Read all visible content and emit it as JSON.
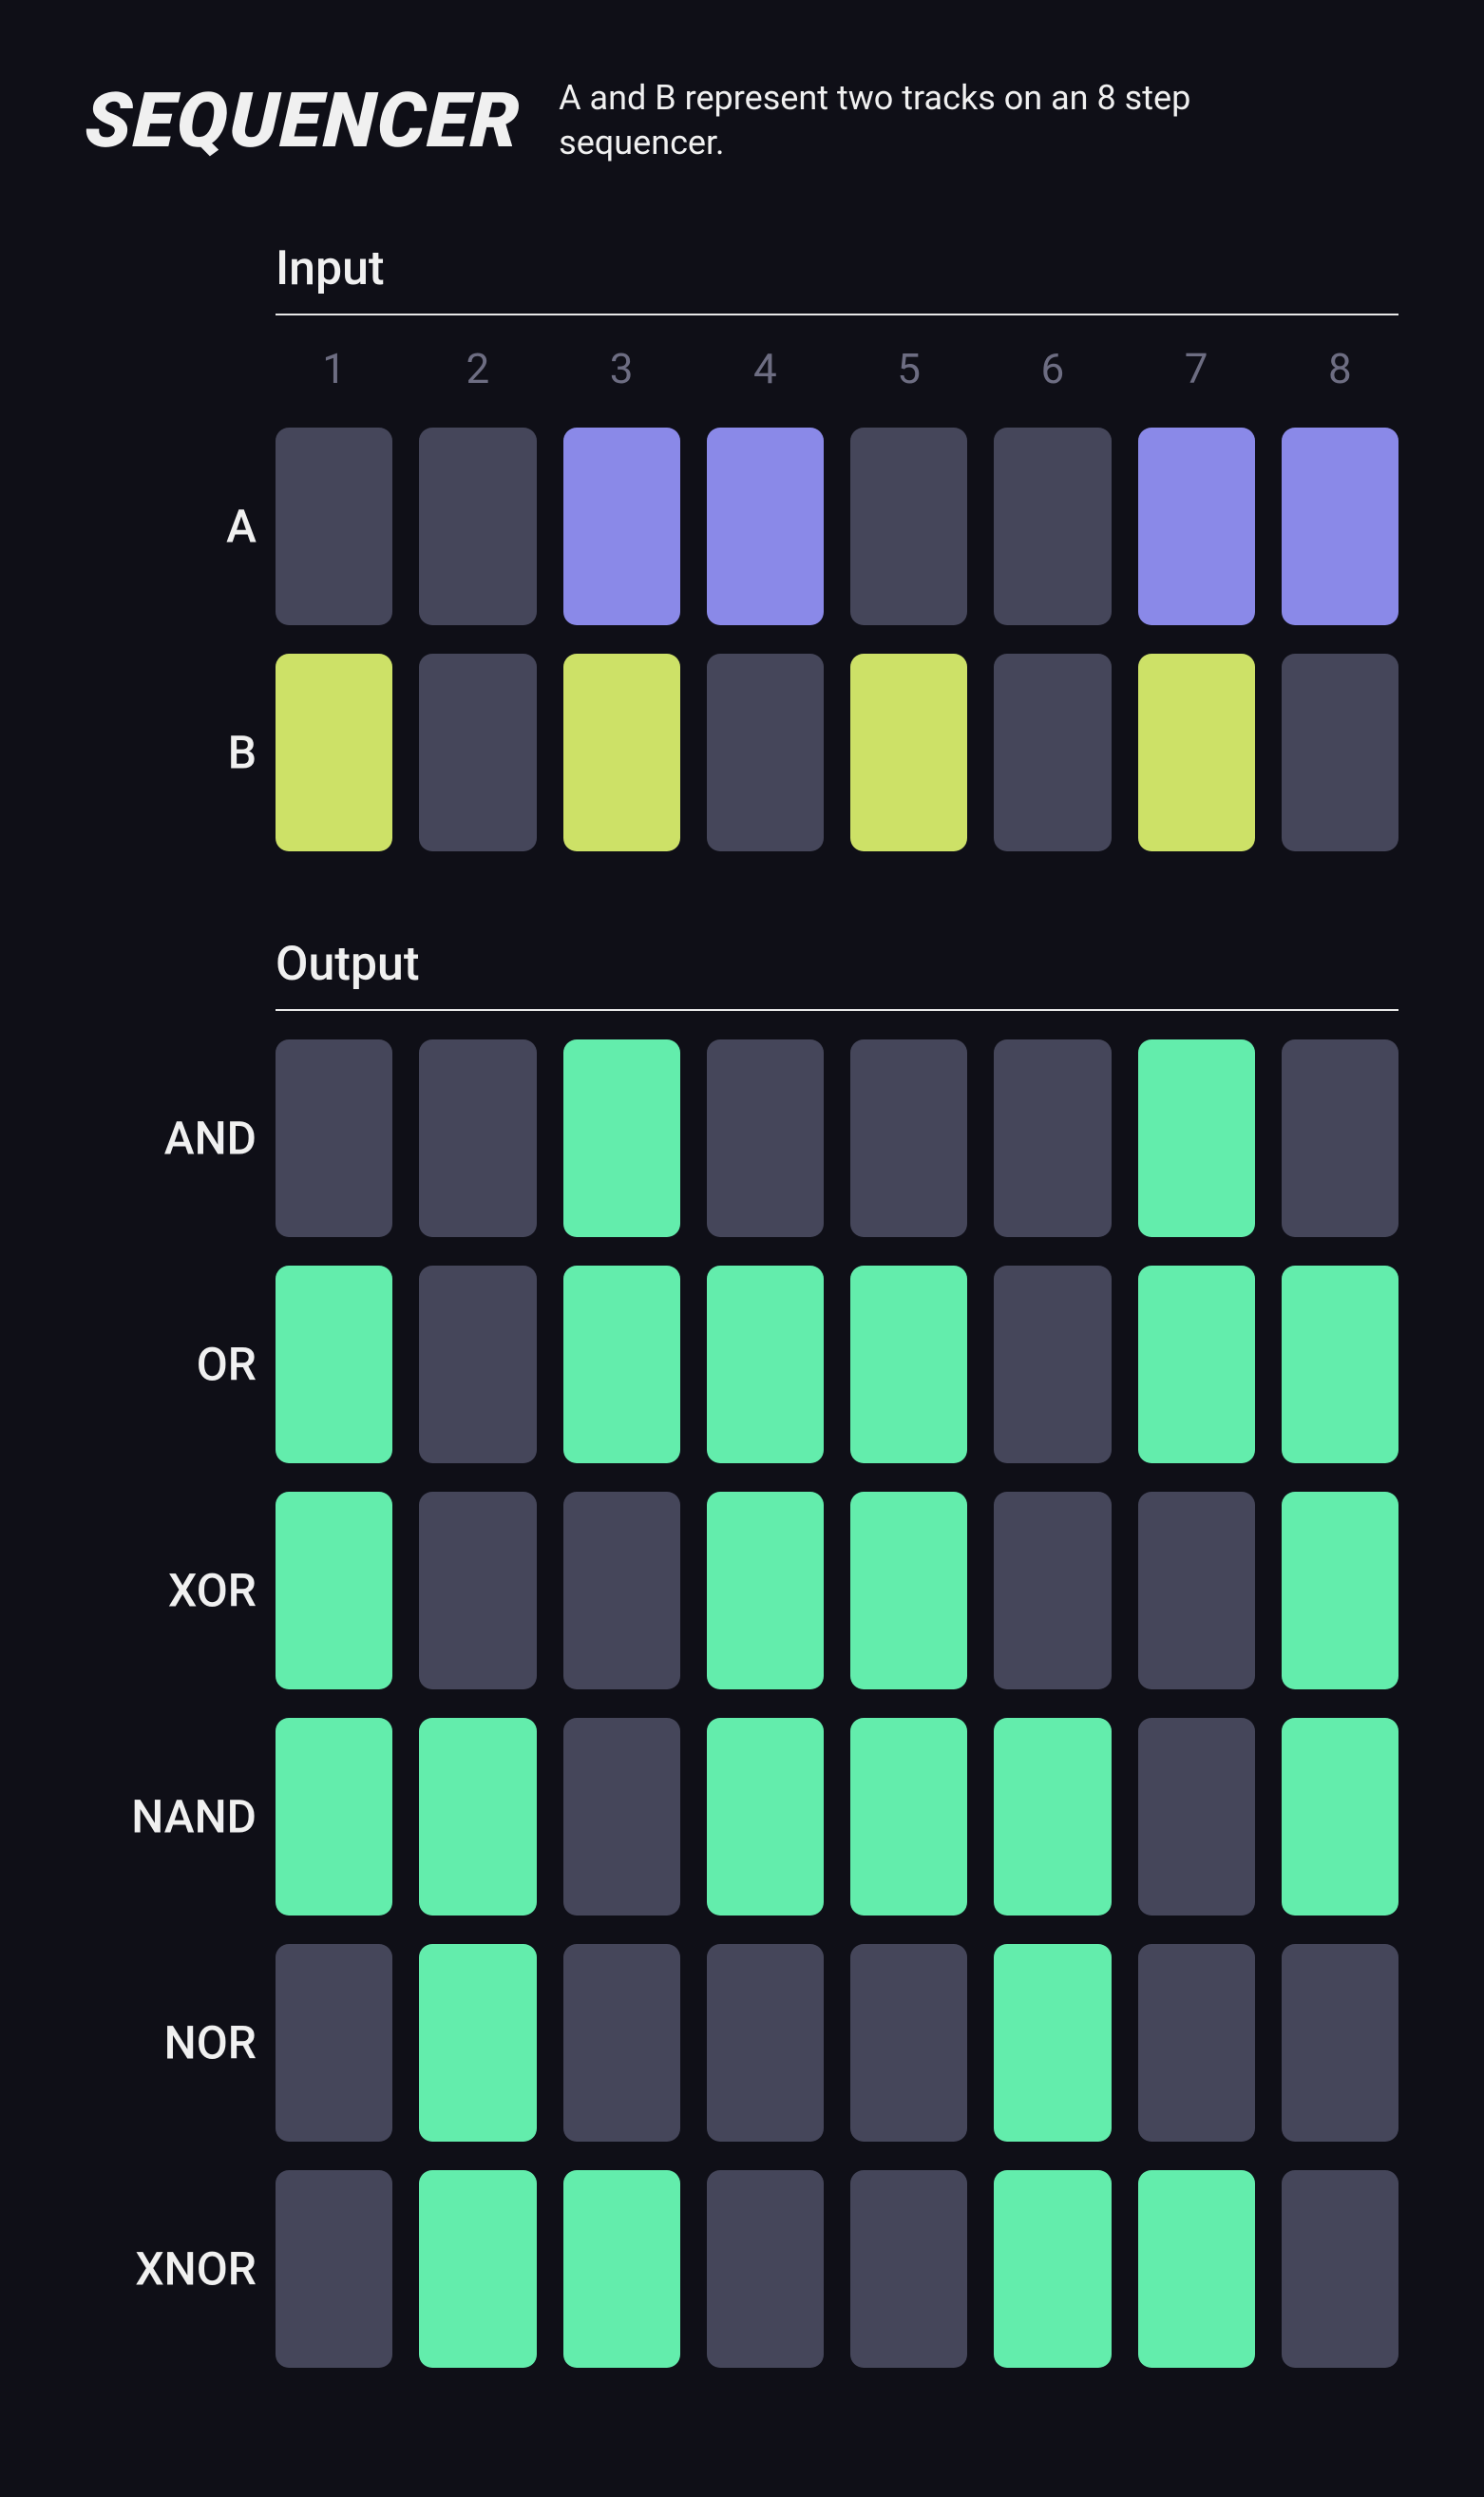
{
  "header": {
    "title": "SEQUENCER",
    "subtitle": "A and B represent two tracks on an 8 step sequencer."
  },
  "sections": {
    "input_heading": "Input",
    "output_heading": "Output"
  },
  "columns": [
    "1",
    "2",
    "3",
    "4",
    "5",
    "6",
    "7",
    "8"
  ],
  "input_rows": [
    {
      "label": "A",
      "color": "purple",
      "on": [
        0,
        0,
        1,
        1,
        0,
        0,
        1,
        1
      ]
    },
    {
      "label": "B",
      "color": "lime",
      "on": [
        1,
        0,
        1,
        0,
        1,
        0,
        1,
        0
      ]
    }
  ],
  "output_rows": [
    {
      "label": "AND",
      "color": "mint",
      "on": [
        0,
        0,
        1,
        0,
        0,
        0,
        1,
        0
      ]
    },
    {
      "label": "OR",
      "color": "mint",
      "on": [
        1,
        0,
        1,
        1,
        1,
        0,
        1,
        1
      ]
    },
    {
      "label": "XOR",
      "color": "mint",
      "on": [
        1,
        0,
        0,
        1,
        1,
        0,
        0,
        1
      ]
    },
    {
      "label": "NAND",
      "color": "mint",
      "on": [
        1,
        1,
        0,
        1,
        1,
        1,
        0,
        1
      ]
    },
    {
      "label": "NOR",
      "color": "mint",
      "on": [
        0,
        1,
        0,
        0,
        0,
        1,
        0,
        0
      ]
    },
    {
      "label": "XNOR",
      "color": "mint",
      "on": [
        0,
        1,
        1,
        0,
        0,
        1,
        1,
        0
      ]
    }
  ],
  "chart_data": {
    "type": "table",
    "title": "Sequencer logic-gate outputs for tracks A and B over 8 steps",
    "columns": [
      "1",
      "2",
      "3",
      "4",
      "5",
      "6",
      "7",
      "8"
    ],
    "inputs": {
      "A": [
        0,
        0,
        1,
        1,
        0,
        0,
        1,
        1
      ],
      "B": [
        1,
        0,
        1,
        0,
        1,
        0,
        1,
        0
      ]
    },
    "outputs": {
      "AND": [
        0,
        0,
        1,
        0,
        0,
        0,
        1,
        0
      ],
      "OR": [
        1,
        0,
        1,
        1,
        1,
        0,
        1,
        1
      ],
      "XOR": [
        1,
        0,
        0,
        1,
        1,
        0,
        0,
        1
      ],
      "NAND": [
        1,
        1,
        0,
        1,
        1,
        1,
        0,
        1
      ],
      "NOR": [
        0,
        1,
        0,
        0,
        0,
        1,
        0,
        0
      ],
      "XNOR": [
        0,
        1,
        1,
        0,
        0,
        1,
        1,
        0
      ]
    }
  }
}
